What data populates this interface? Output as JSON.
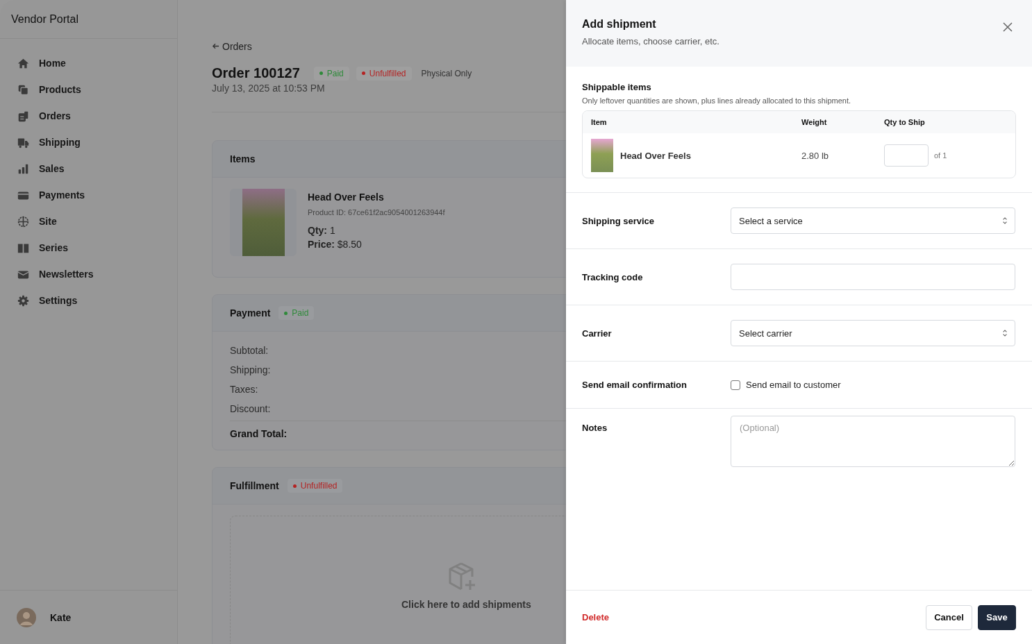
{
  "sidebar": {
    "title": "Vendor Portal",
    "items": [
      {
        "label": "Home"
      },
      {
        "label": "Products"
      },
      {
        "label": "Orders"
      },
      {
        "label": "Shipping"
      },
      {
        "label": "Sales"
      },
      {
        "label": "Payments"
      },
      {
        "label": "Site"
      },
      {
        "label": "Series"
      },
      {
        "label": "Newsletters"
      },
      {
        "label": "Settings"
      }
    ],
    "user": {
      "name": "Kate"
    }
  },
  "order": {
    "back_link": "Orders",
    "title": "Order 100127",
    "badges": [
      {
        "label": "Paid",
        "color": "#2f8a3a"
      },
      {
        "label": "Unfulfilled",
        "color": "#b42323"
      }
    ],
    "tag": "Physical Only",
    "date": "July 13, 2025 at 10:53 PM",
    "items_card": {
      "title": "Items",
      "product": {
        "name": "Head Over Feels",
        "product_id": "Product ID: 67ce61f2ac9054001263944f",
        "qty_label": "Qty:",
        "qty": "1",
        "price_label": "Price:",
        "price": "$8.50"
      }
    },
    "payment_card": {
      "title": "Payment",
      "badge": {
        "label": "Paid",
        "color": "#2f8a3a"
      },
      "lines": [
        "Subtotal:",
        "Shipping:",
        "Taxes:",
        "Discount:"
      ],
      "total_label": "Grand Total:"
    },
    "fulfillment_card": {
      "title": "Fulfillment",
      "badge": {
        "label": "Unfulfilled",
        "color": "#b42323"
      },
      "empty_text": "Click here to add shipments"
    }
  },
  "drawer": {
    "title": "Add shipment",
    "subtitle": "Allocate items, choose carrier, etc.",
    "shippable": {
      "title": "Shippable items",
      "note": "Only leftover quantities are shown, plus lines already allocated to this shipment.",
      "columns": [
        "Item",
        "Weight",
        "Qty to Ship"
      ],
      "rows": [
        {
          "item": "Head Over Feels",
          "weight": "2.80 lb",
          "of": "of 1"
        }
      ]
    },
    "fields": [
      {
        "kind": "select",
        "label": "Shipping service",
        "value": "Select a service"
      },
      {
        "kind": "text",
        "label": "Tracking code"
      },
      {
        "kind": "select",
        "label": "Carrier",
        "value": "Select carrier"
      },
      {
        "kind": "checkbox",
        "label": "Send email confirmation",
        "option": "Send email to customer",
        "checked": false
      },
      {
        "kind": "textarea",
        "label": "Notes",
        "placeholder": "(Optional)"
      }
    ],
    "delete": "Delete",
    "cancel": "Cancel",
    "save": "Save"
  }
}
